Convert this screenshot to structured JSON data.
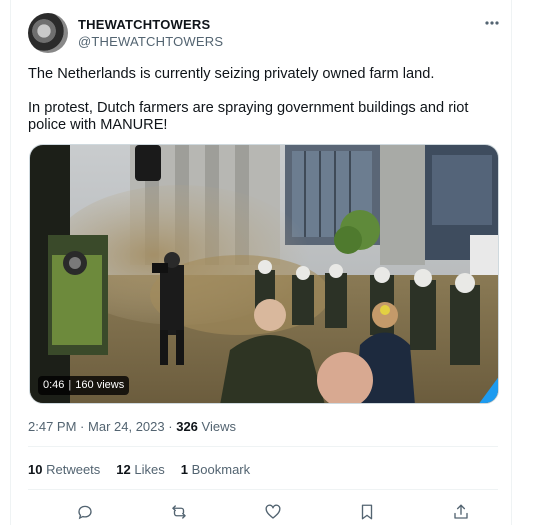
{
  "author": {
    "name": "THEWATCHTOWERS",
    "handle": "@THEWATCHTOWERS"
  },
  "more_icon": "more-horizontal-icon",
  "tweet": {
    "paragraphs": [
      "The Netherlands is currently seizing privately owned farm land.",
      "In protest, Dutch farmers are spraying government buildings and riot police with MANURE!"
    ]
  },
  "video": {
    "duration": "0:46",
    "views": "160 views"
  },
  "meta": {
    "time": "2:47 PM",
    "separator1": "·",
    "date": "Mar 24, 2023",
    "separator2": "·",
    "views_count": "326",
    "views_label": "Views"
  },
  "stats": {
    "retweets_count": "10",
    "retweets_label": "Retweets",
    "likes_count": "12",
    "likes_label": "Likes",
    "bookmarks_count": "1",
    "bookmarks_label": "Bookmark"
  },
  "actions": [
    "reply-icon",
    "retweet-icon",
    "like-icon",
    "bookmark-icon",
    "share-icon"
  ],
  "colors": {
    "text": "#0f1419",
    "secondary": "#536471",
    "border": "#eff3f4",
    "video_accent": "#1d9bf0"
  }
}
